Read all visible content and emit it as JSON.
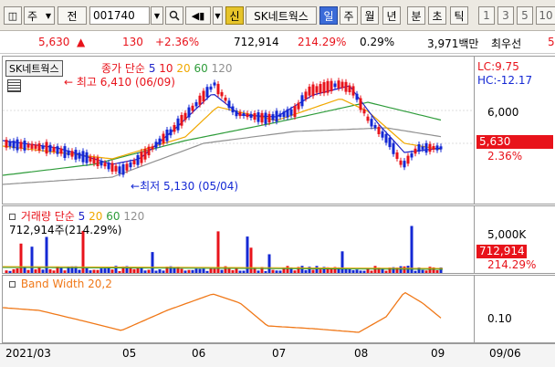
{
  "toolbar": {
    "market_type": "주",
    "prefix": "전",
    "code": "001740",
    "buy_label": "신",
    "name": "SK네트웍스",
    "periods": [
      "일",
      "주",
      "월",
      "년",
      "분",
      "초",
      "틱"
    ],
    "active_period": "일",
    "numbers": [
      "1",
      "3",
      "5",
      "10"
    ]
  },
  "quote": {
    "price": "5,630",
    "arrow": "▲",
    "change": "130",
    "change_pct": "+2.36%",
    "volume": "712,914",
    "volume_pct": "214.29%",
    "turnover": "0.29%",
    "trade_value": "3,971백만",
    "pref_label": "최우선",
    "pref_value": "5"
  },
  "price_panel": {
    "stock_label": "SK네트웍스",
    "ma_title": "종가 단순",
    "ma_periods": [
      "5",
      "10",
      "20",
      "60",
      "120"
    ],
    "high_note": "최고 6,410 (06/09)",
    "low_note": "최저 5,130 (05/04)",
    "lc": "LC:9.75",
    "hc": "HC:-12.17",
    "axis_label": "6,000",
    "last_price": "5,630",
    "last_pct": "2.36%"
  },
  "volume_panel": {
    "title": "거래량 단순",
    "ma_periods": [
      "5",
      "20",
      "60",
      "120"
    ],
    "current": "712,914주(214.29%)",
    "axis_label": "5,000K",
    "last_volume": "712,914",
    "last_pct": "214.29%"
  },
  "bw_panel": {
    "title": "Band Width 20,2",
    "axis_label": "0.10"
  },
  "x_axis": {
    "labels": [
      "2021/03",
      "05",
      "06",
      "07",
      "08",
      "09"
    ],
    "right_label": "09/06"
  },
  "colors": {
    "up": "#e8131b",
    "down": "#1428d4",
    "ma5": "#1e23c8",
    "ma20": "#f0a800",
    "ma60": "#2e9c3a",
    "ma120": "#909090",
    "bw": "#f07818"
  }
}
